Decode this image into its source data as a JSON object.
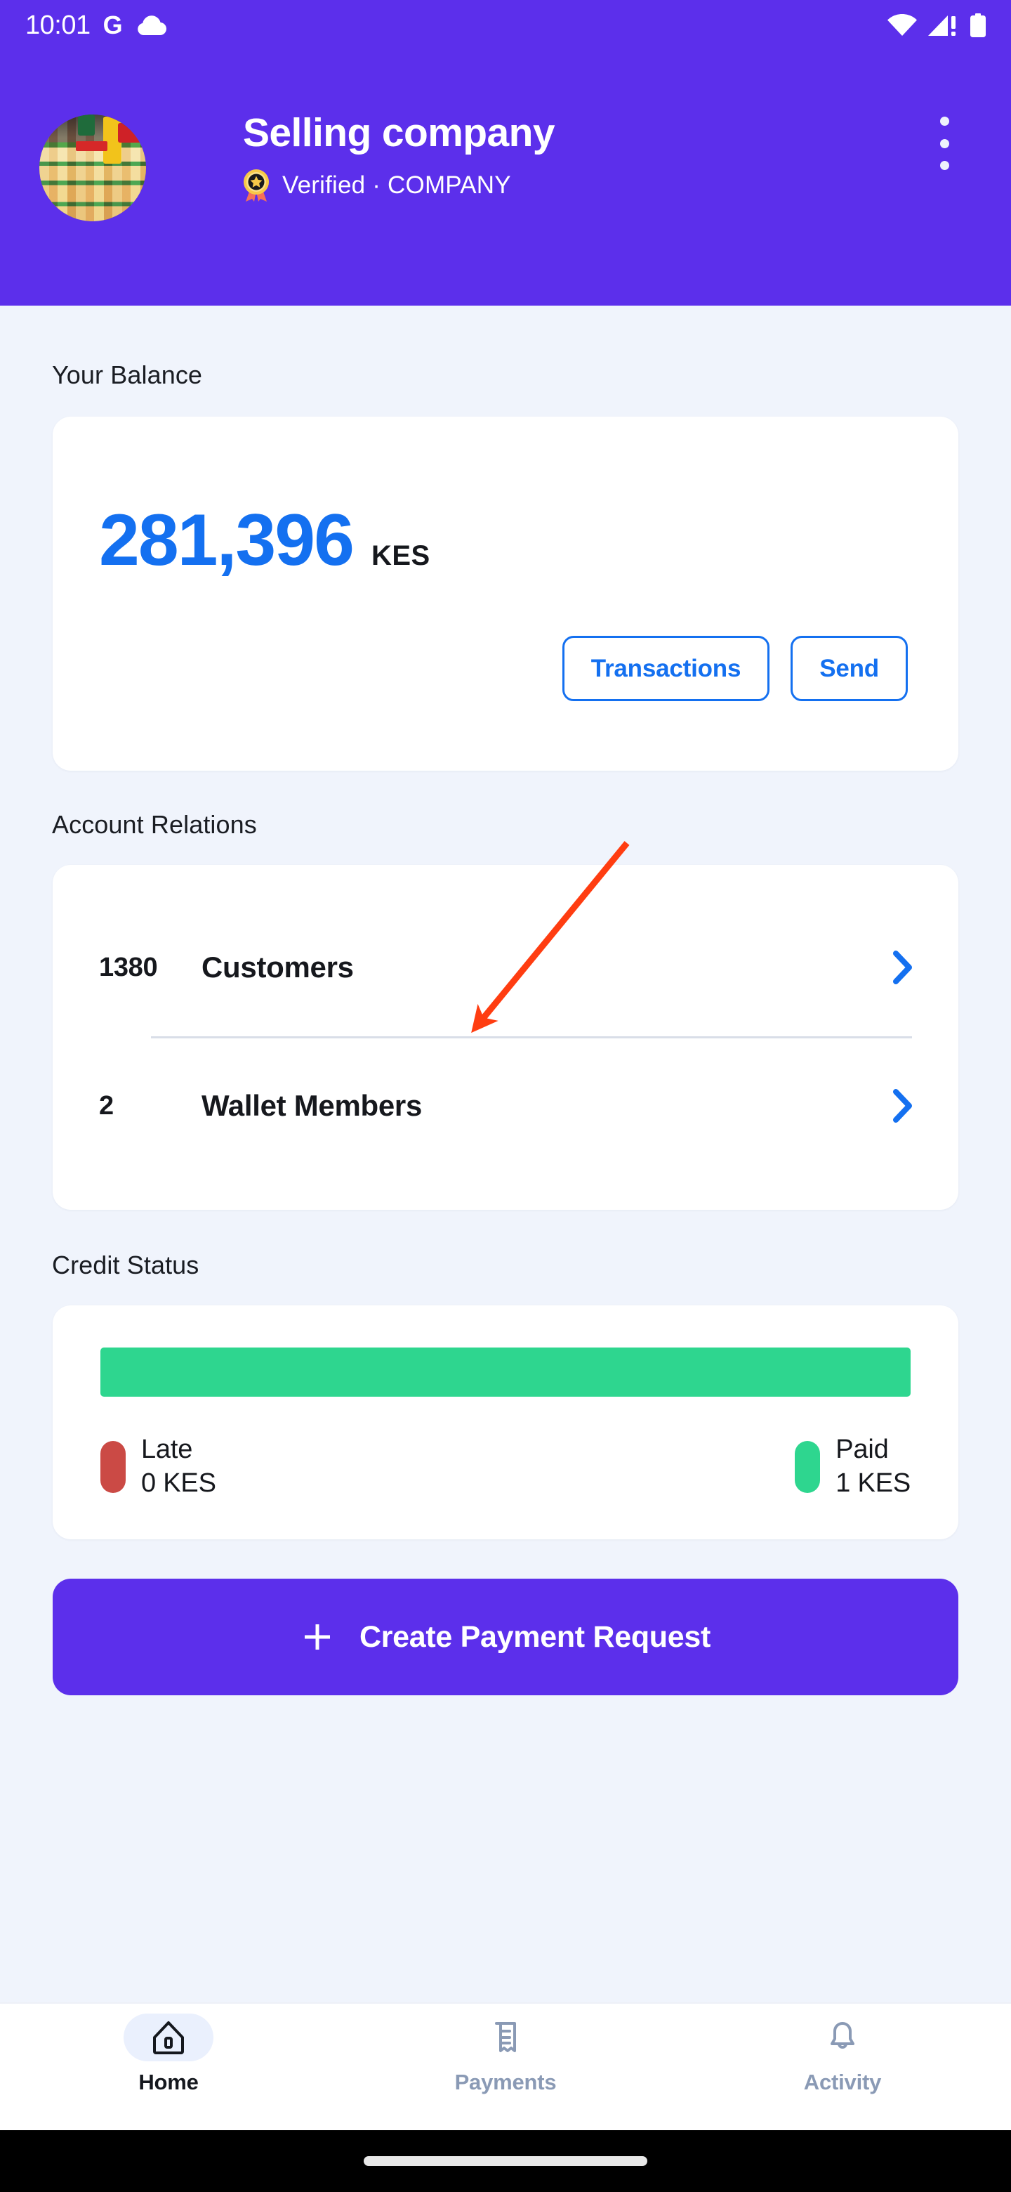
{
  "status_bar": {
    "time": "10:01",
    "google_glyph": "G",
    "icons": [
      "cloud-icon",
      "wifi-icon",
      "cellular-icon",
      "battery-icon"
    ]
  },
  "header": {
    "company_name": "Selling company",
    "verified_text": "Verified · COMPANY",
    "verified_badge_icon": "medal-star-icon",
    "avatar_icon": "company-avatar",
    "menu_icon": "kebab-menu-icon",
    "background_color": "#5C2FEB"
  },
  "balance": {
    "section_label": "Your Balance",
    "amount": "281,396",
    "currency": "KES",
    "amount_color": "#1470F0",
    "transactions_label": "Transactions",
    "send_label": "Send"
  },
  "relations": {
    "section_label": "Account Relations",
    "rows": [
      {
        "count": "1380",
        "name": "Customers",
        "chevron_icon": "chevron-right-icon"
      },
      {
        "count": "2",
        "name": "Wallet Members",
        "chevron_icon": "chevron-right-icon"
      }
    ]
  },
  "credit": {
    "section_label": "Credit Status",
    "paid_percent": 100,
    "late_percent": 0,
    "paid_color": "#2ED68F",
    "late_color": "#CB4A45",
    "legend": [
      {
        "name": "Late",
        "value": "0 KES",
        "color": "#CB4A45"
      },
      {
        "name": "Paid",
        "value": "1 KES",
        "color": "#2ED68F"
      }
    ]
  },
  "cta": {
    "label": "Create Payment Request",
    "icon": "plus-icon",
    "color": "#5C2FEB"
  },
  "bottom_nav": {
    "items": [
      {
        "label": "Home",
        "icon": "home-icon",
        "active": true
      },
      {
        "label": "Payments",
        "icon": "receipt-icon",
        "active": false
      },
      {
        "label": "Activity",
        "icon": "bell-icon",
        "active": false
      }
    ]
  },
  "annotation": {
    "type": "arrow",
    "color": "#FF3D11",
    "points_to": "Customers"
  }
}
